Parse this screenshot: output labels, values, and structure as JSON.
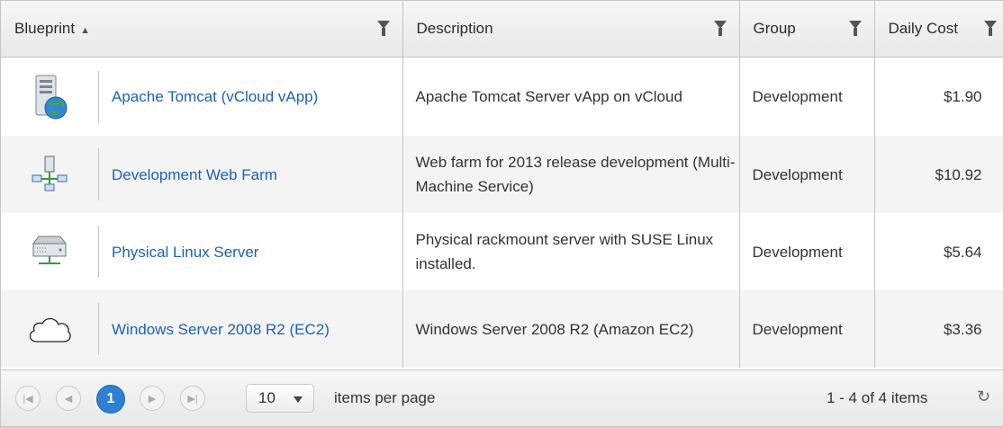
{
  "columns": {
    "blueprint": "Blueprint",
    "description": "Description",
    "group": "Group",
    "daily_cost": "Daily Cost"
  },
  "rows": [
    {
      "icon": "server-globe-icon",
      "name": "Apache Tomcat (vCloud vApp)",
      "description": "Apache Tomcat Server vApp on vCloud",
      "group": "Development",
      "cost": "$1.90"
    },
    {
      "icon": "network-topology-icon",
      "name": "Development Web Farm",
      "description": "Web farm for 2013 release development (Multi-Machine Service)",
      "group": "Development",
      "cost": "$10.92"
    },
    {
      "icon": "rackmount-server-icon",
      "name": "Physical Linux Server",
      "description": "Physical rackmount server with SUSE Linux installed.",
      "group": "Development",
      "cost": "$5.64"
    },
    {
      "icon": "cloud-icon",
      "name": "Windows Server 2008 R2 (EC2)",
      "description": "Windows Server 2008 R2 (Amazon EC2)",
      "group": "Development",
      "cost": "$3.36"
    }
  ],
  "pager": {
    "current_page": "1",
    "page_size": "10",
    "items_per_page_label": "items per page",
    "info": "1 - 4 of 4 items"
  },
  "colors": {
    "link": "#1a62b8",
    "current_page": "#2f7fd3"
  }
}
